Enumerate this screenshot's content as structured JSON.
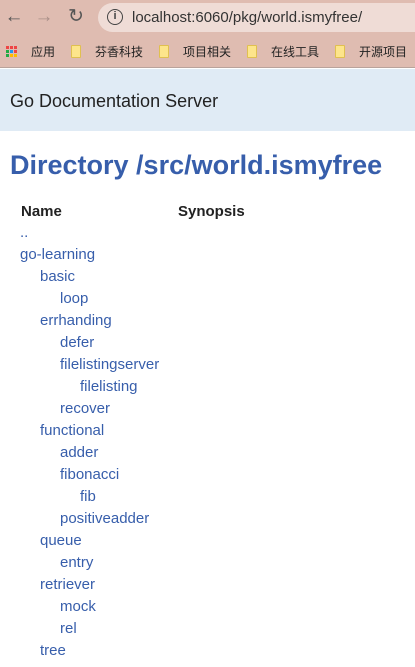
{
  "browser": {
    "url": "localhost:6060/pkg/world.ismyfree/",
    "bookmarks": [
      "应用",
      "芬香科技",
      "项目相关",
      "在线工具",
      "开源项目"
    ]
  },
  "header": {
    "title": "Go Documentation Server"
  },
  "page": {
    "title": "Directory /src/world.ismyfree",
    "columns": [
      "Name",
      "Synopsis"
    ],
    "rows": [
      {
        "name": "..",
        "depth": 0
      },
      {
        "name": "go-learning",
        "depth": 0
      },
      {
        "name": "basic",
        "depth": 1
      },
      {
        "name": "loop",
        "depth": 2
      },
      {
        "name": "errhanding",
        "depth": 1
      },
      {
        "name": "defer",
        "depth": 2
      },
      {
        "name": "filelistingserver",
        "depth": 2
      },
      {
        "name": "filelisting",
        "depth": 3
      },
      {
        "name": "recover",
        "depth": 2
      },
      {
        "name": "functional",
        "depth": 1
      },
      {
        "name": "adder",
        "depth": 2
      },
      {
        "name": "fibonacci",
        "depth": 2
      },
      {
        "name": "fib",
        "depth": 3
      },
      {
        "name": "positiveadder",
        "depth": 2
      },
      {
        "name": "queue",
        "depth": 1
      },
      {
        "name": "entry",
        "depth": 2
      },
      {
        "name": "retriever",
        "depth": 1
      },
      {
        "name": "mock",
        "depth": 2
      },
      {
        "name": "rel",
        "depth": 2
      },
      {
        "name": "tree",
        "depth": 1
      }
    ]
  },
  "colors": {
    "link": "#375eab",
    "header_bg": "#e0ebf5",
    "chrome": "#dfbcb1"
  }
}
